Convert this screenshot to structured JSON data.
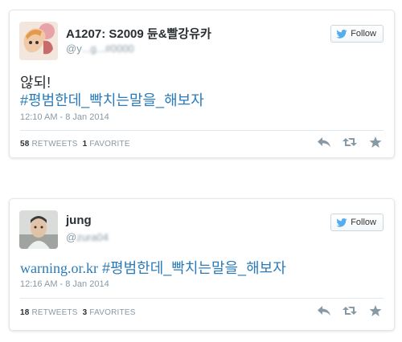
{
  "tweets": [
    {
      "name": "A1207: S2009 듄&빨강유카",
      "handle_prefix": "@y",
      "handle_obscured": "...g...#0000",
      "text_plain": "않되!",
      "hashtag": "#평범한데_빡치는말을_해보자",
      "timestamp": "12:10 AM - 8 Jan 2014",
      "retweets_count": "58",
      "retweets_label": "RETWEETS",
      "favorites_count": "1",
      "favorites_label": "FAVORITE",
      "follow_label": "Follow"
    },
    {
      "name": "jung",
      "handle_prefix": "@",
      "handle_obscured": "zura04",
      "url_text": "warning.or.kr",
      "hashtag": "#평범한데_빡치는말을_해보자",
      "timestamp": "12:16 AM - 8 Jan 2014",
      "retweets_count": "18",
      "retweets_label": "RETWEETS",
      "favorites_count": "3",
      "favorites_label": "FAVORITES",
      "follow_label": "Follow"
    }
  ],
  "colors": {
    "link": "#2b7bb9",
    "muted": "#8899a6",
    "text": "#292f33",
    "border": "#e1e8ed",
    "twitter_blue": "#55acee"
  },
  "icons": [
    "twitter-bird-icon",
    "reply-icon",
    "retweet-icon",
    "favorite-star-icon"
  ]
}
